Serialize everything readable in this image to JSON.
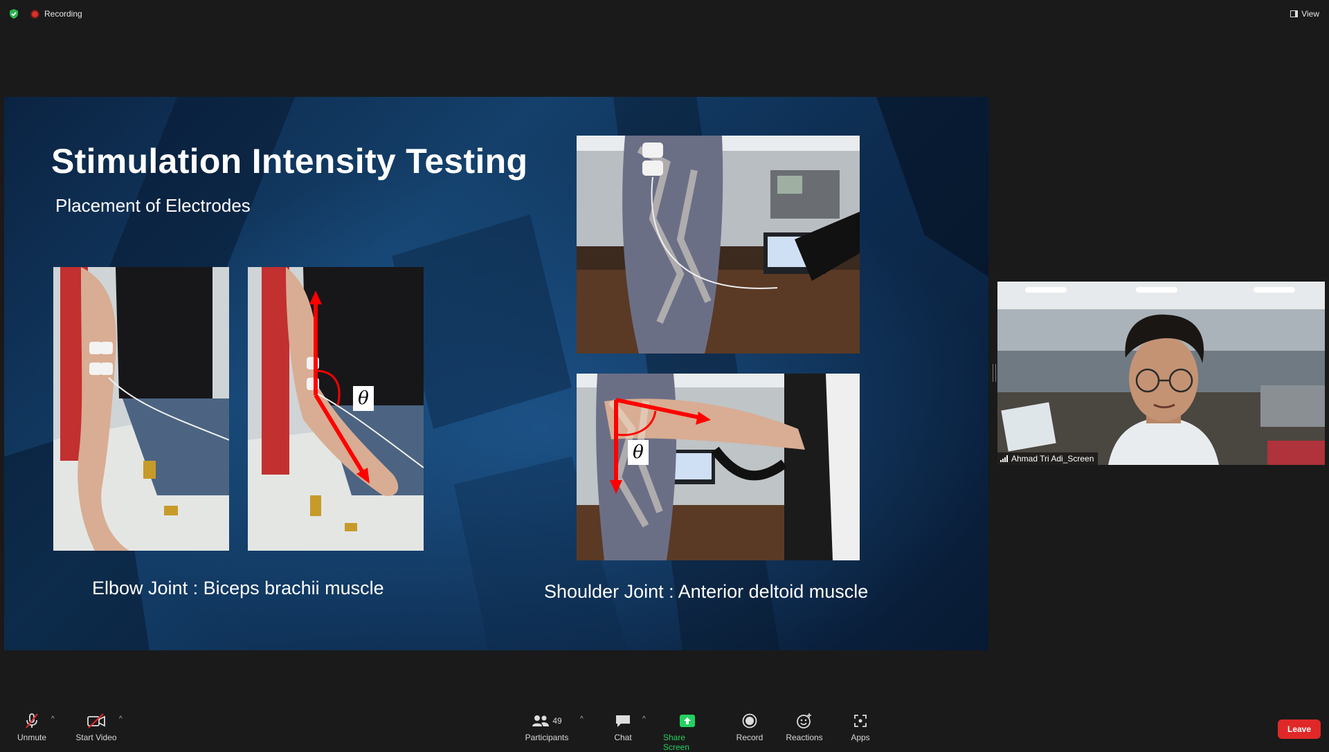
{
  "topbar": {
    "recording_label": "Recording",
    "view_label": "View"
  },
  "slide": {
    "title": "Stimulation Intensity Testing",
    "subtitle": "Placement of Electrodes",
    "caption_left": "Elbow Joint : Biceps brachii muscle",
    "caption_right": "Shoulder Joint : Anterior deltoid muscle",
    "theta_symbol": "θ"
  },
  "participant": {
    "name": "Ahmad Tri Adi_Screen"
  },
  "toolbar": {
    "unmute_label": "Unmute",
    "start_video_label": "Start Video",
    "participants_label": "Participants",
    "participants_count": "49",
    "chat_label": "Chat",
    "share_screen_label": "Share Screen",
    "record_label": "Record",
    "reactions_label": "Reactions",
    "apps_label": "Apps",
    "leave_label": "Leave"
  },
  "colors": {
    "share_green": "#23d160",
    "leave_red": "#e02828",
    "recording_red": "#d9322b",
    "arrow_red": "#ff0000"
  }
}
